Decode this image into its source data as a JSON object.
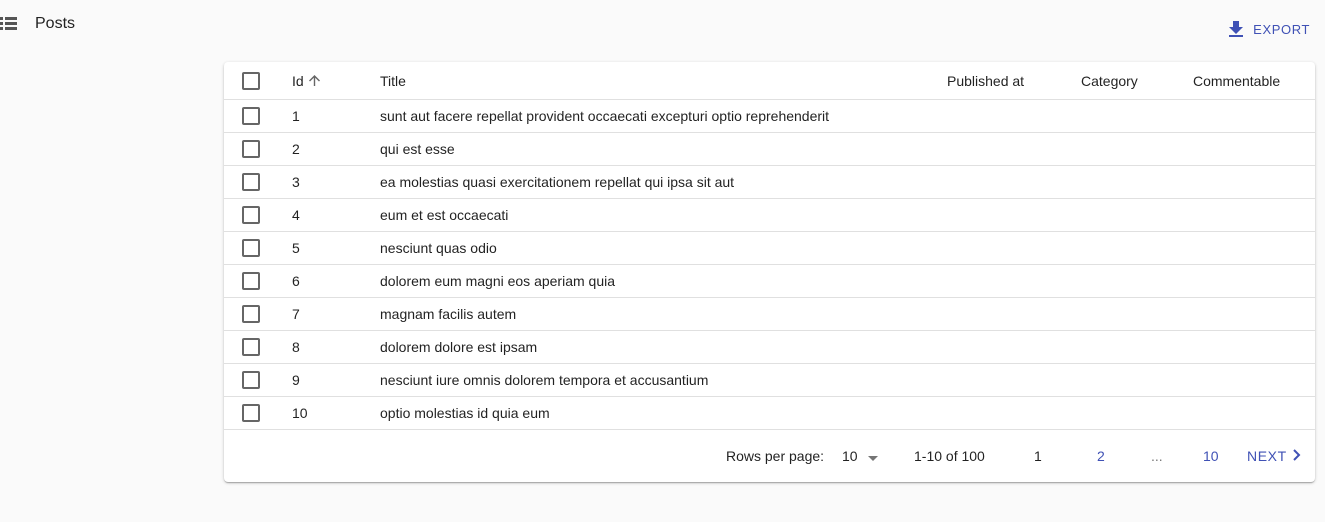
{
  "header": {
    "title": "Posts",
    "export_label": "EXPORT"
  },
  "table": {
    "columns": {
      "id": "Id",
      "title": "Title",
      "published_at": "Published at",
      "category": "Category",
      "commentable": "Commentable"
    },
    "sort": {
      "column": "id",
      "direction": "asc"
    },
    "rows": [
      {
        "id": "1",
        "title": "sunt aut facere repellat provident occaecati excepturi optio reprehenderit"
      },
      {
        "id": "2",
        "title": "qui est esse"
      },
      {
        "id": "3",
        "title": "ea molestias quasi exercitationem repellat qui ipsa sit aut"
      },
      {
        "id": "4",
        "title": "eum et est occaecati"
      },
      {
        "id": "5",
        "title": "nesciunt quas odio"
      },
      {
        "id": "6",
        "title": "dolorem eum magni eos aperiam quia"
      },
      {
        "id": "7",
        "title": "magnam facilis autem"
      },
      {
        "id": "8",
        "title": "dolorem dolore est ipsam"
      },
      {
        "id": "9",
        "title": "nesciunt iure omnis dolorem tempora et accusantium"
      },
      {
        "id": "10",
        "title": "optio molestias id quia eum"
      }
    ]
  },
  "pagination": {
    "rows_per_page_label": "Rows per page:",
    "rows_per_page_value": "10",
    "range": "1-10 of 100",
    "pages": [
      "1",
      "2",
      "...",
      "10"
    ],
    "next_label": "NEXT"
  },
  "colors": {
    "accent": "#3f51b5",
    "background": "#fafafa"
  }
}
